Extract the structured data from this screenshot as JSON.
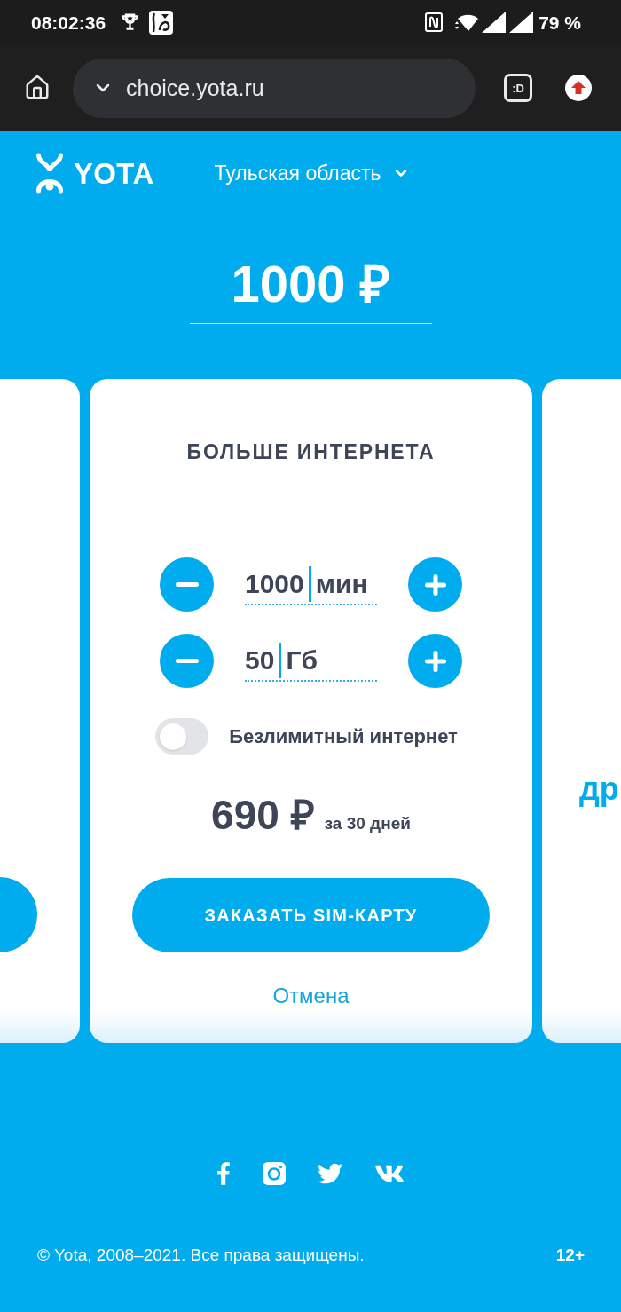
{
  "status_bar": {
    "time": "08:02:36",
    "battery": "79 %"
  },
  "browser": {
    "url": "choice.yota.ru",
    "tab_count": ":D"
  },
  "header": {
    "logo": "YOTA",
    "region": "Тульская область"
  },
  "amount": {
    "value": "1000 ₽"
  },
  "tariff_card": {
    "title": "БОЛЬШЕ ИНТЕРНЕТА",
    "steppers": [
      {
        "value": "1000",
        "unit": "мин"
      },
      {
        "value": "50",
        "unit": "Гб"
      }
    ],
    "unlimited": {
      "label": "Безлимитный интернет",
      "on": false
    },
    "price": "690 ₽",
    "period": "за 30 дней",
    "order_button": "ЗАКАЗАТЬ SIM-КАРТУ",
    "cancel_link": "Отмена"
  },
  "next_card": {
    "title": "др"
  },
  "footer": {
    "social": [
      {
        "kind": "facebook"
      },
      {
        "kind": "instagram"
      },
      {
        "kind": "twitter"
      },
      {
        "kind": "vk"
      }
    ],
    "copyright": "© Yota, 2008–2021. Все права защищены.",
    "age_rating": "12+"
  }
}
